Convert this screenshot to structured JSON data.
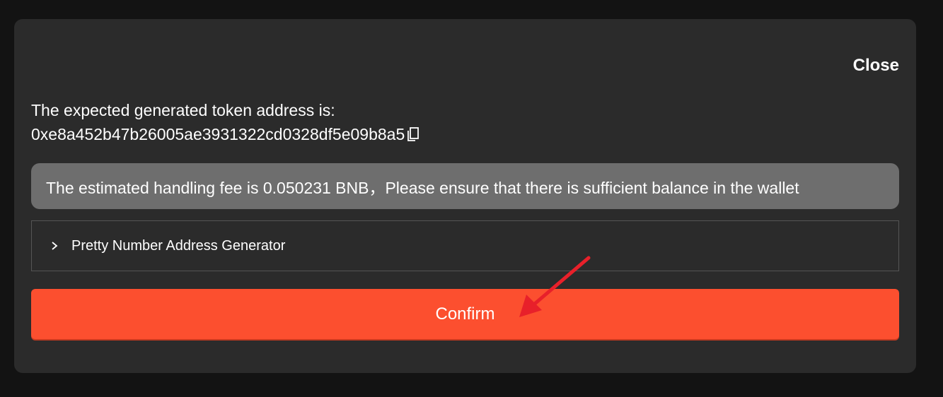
{
  "modal": {
    "close_label": "Close",
    "address_intro": "The expected generated token address is:",
    "token_address": "0xe8a452b47b26005ae3931322cd0328df5e09b8a5",
    "fee_notice": "The estimated handling fee is 0.050231 BNB，Please ensure that there is sufficient balance in the wallet",
    "generator_label": "Pretty Number Address Generator",
    "confirm_label": "Confirm"
  },
  "colors": {
    "background": "#131313",
    "modal_bg": "#2b2b2b",
    "fee_box_bg": "#6e6e6e",
    "confirm_bg": "#fc4f2f",
    "annotation_arrow": "#e8202a"
  }
}
